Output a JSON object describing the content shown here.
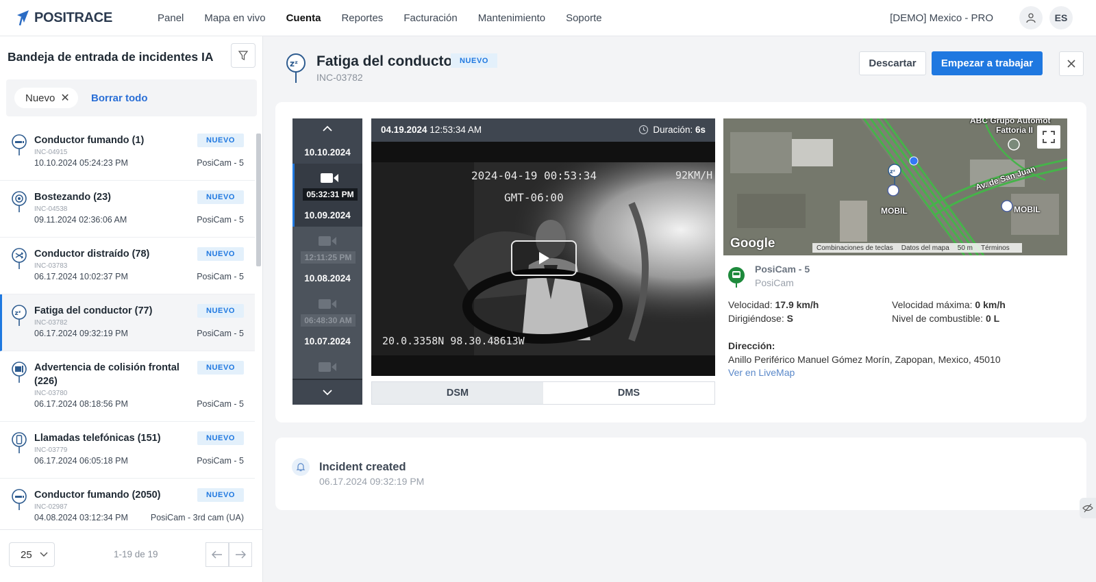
{
  "app": {
    "logo_text": "POSITRACE",
    "nav": [
      "Panel",
      "Mapa en vivo",
      "Cuenta",
      "Reportes",
      "Facturación",
      "Mantenimiento",
      "Soporte"
    ],
    "account": "[DEMO] Mexico - PRO",
    "lang": "ES",
    "accent_color": "#1f78e0"
  },
  "sidebar": {
    "title": "Bandeja de entrada de incidentes IA",
    "filter_chip": "Nuevo",
    "clear_all": "Borrar todo",
    "incidents": [
      {
        "name": "Conductor fumando (1)",
        "code": "INC-04915",
        "date": "10.10.2024 05:24:23 PM",
        "badge": "NUEVO",
        "camera": "PosiCam - 5",
        "icon": "smoking-icon"
      },
      {
        "name": "Bostezando (23)",
        "code": "INC-04538",
        "date": "09.11.2024 02:36:06 AM",
        "badge": "NUEVO",
        "camera": "PosiCam - 5",
        "icon": "yawning-icon"
      },
      {
        "name": "Conductor distraído (78)",
        "code": "INC-03783",
        "date": "06.17.2024 10:02:37 PM",
        "badge": "NUEVO",
        "camera": "PosiCam - 5",
        "icon": "distracted-icon"
      },
      {
        "name": "Fatiga del conductor (77)",
        "code": "INC-03782",
        "date": "06.17.2024 09:32:19 PM",
        "badge": "NUEVO",
        "camera": "PosiCam - 5",
        "icon": "fatigue-icon"
      },
      {
        "name": "Advertencia de colisión frontal (226)",
        "code": "INC-03780",
        "date": "06.17.2024 08:18:56 PM",
        "badge": "NUEVO",
        "camera": "PosiCam - 5",
        "icon": "collision-icon"
      },
      {
        "name": "Llamadas telefónicas (151)",
        "code": "INC-03779",
        "date": "06.17.2024 06:05:18 PM",
        "badge": "NUEVO",
        "camera": "PosiCam - 5",
        "icon": "phone-icon"
      },
      {
        "name": "Conductor fumando (2050)",
        "code": "INC-02987",
        "date": "04.08.2024 03:12:34 PM",
        "badge": "NUEVO",
        "camera": "PosiCam - 3rd cam (UA)",
        "icon": "smoking-icon"
      }
    ],
    "pager": {
      "per_page": "25",
      "info": "1-19 de 19"
    }
  },
  "incident": {
    "title": "Fatiga del conductor",
    "badge": "NUEVO",
    "code": "INC-03782",
    "discard": "Descartar",
    "start": "Empezar a trabajar"
  },
  "timeline": {
    "entries": [
      {
        "date": "10.10.2024",
        "time": "05:32:31 PM"
      },
      {
        "date": "10.09.2024",
        "time": "12:11:25 PM"
      },
      {
        "date": "10.08.2024",
        "time": "06:48:30 AM"
      },
      {
        "date": "10.07.2024",
        "time": ""
      }
    ]
  },
  "video": {
    "date": "04.19.2024",
    "time": "12:53:34 AM",
    "duration_label": "Duración:",
    "duration": "6s",
    "osd_timestamp": "2024-04-19 00:53:34",
    "osd_tz": "GMT-06:00",
    "osd_speed": "92KM/H",
    "osd_coords": "20.0.3358N 98.30.48613W",
    "tabs": [
      "DSM",
      "DMS"
    ]
  },
  "map": {
    "brand": "Google",
    "attributions": [
      "Combinaciones de teclas",
      "Datos del mapa",
      "50 m",
      "Términos"
    ],
    "labels": [
      "ABC Grupo Automot",
      "Fattoria II",
      "Av. de San Juan",
      "MOBIL",
      "MOBIL"
    ]
  },
  "vehicle": {
    "name": "PosiCam - 5",
    "group": "PosiCam",
    "speed_label": "Velocidad:",
    "speed": "17.9 km/h",
    "max_speed_label": "Velocidad máxima:",
    "max_speed": "0 km/h",
    "heading_label": "Dirigiéndose:",
    "heading": "S",
    "fuel_label": "Nivel de combustible:",
    "fuel": "0 L",
    "address_label": "Dirección:",
    "address": "Anillo Periférico Manuel Gómez Morín, Zapopan, Mexico, 45010",
    "livemap": "Ver en LiveMap"
  },
  "event": {
    "title": "Incident created",
    "date": "06.17.2024 09:32:19 PM"
  }
}
